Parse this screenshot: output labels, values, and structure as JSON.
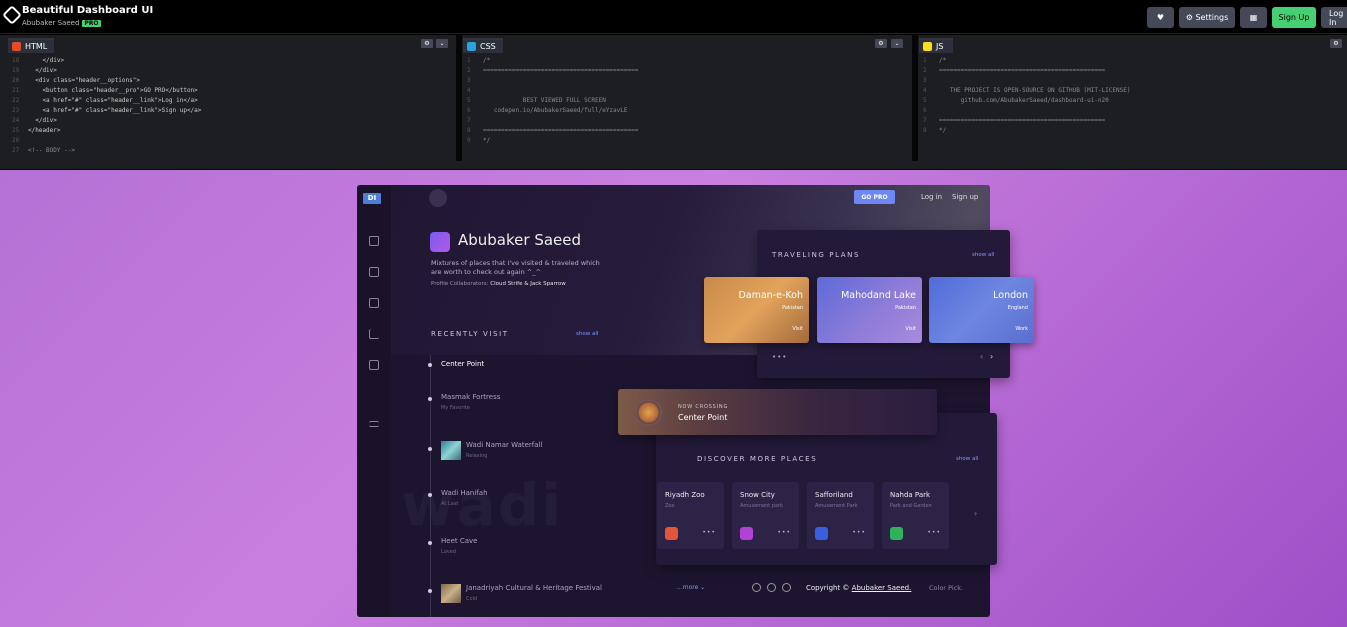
{
  "codepen": {
    "title": "Beautiful Dashboard UI",
    "author": "Abubaker Saeed",
    "badge": "PRO",
    "buttons": {
      "settings": "Settings",
      "signup": "Sign Up",
      "login": "Log In"
    }
  },
  "editors": {
    "html": {
      "label": "HTML",
      "lines": [
        {
          "n": "18",
          "t": "    </div>"
        },
        {
          "n": "19",
          "t": "  </div>"
        },
        {
          "n": "20",
          "t": "  <div class=\"header__options\">"
        },
        {
          "n": "21",
          "t": "    <button class=\"header__pro\">GO PRO</button>"
        },
        {
          "n": "22",
          "t": "    <a href=\"#\" class=\"header__link\">Log in</a>"
        },
        {
          "n": "23",
          "t": "    <a href=\"#\" class=\"header__link\">Sign up</a>"
        },
        {
          "n": "24",
          "t": "  </div>"
        },
        {
          "n": "25",
          "t": "</header>"
        },
        {
          "n": "26",
          "t": ""
        },
        {
          "n": "27",
          "t": "<!-- BODY -->"
        }
      ]
    },
    "css": {
      "label": "CSS",
      "lines": [
        {
          "n": "1",
          "t": "/*"
        },
        {
          "n": "2",
          "t": "==========================================="
        },
        {
          "n": "3",
          "t": ""
        },
        {
          "n": "4",
          "t": ""
        },
        {
          "n": "5",
          "t": "           BEST VIEWED FULL SCREEN"
        },
        {
          "n": "6",
          "t": "   codepen.io/AbubakerSaeed/full/eYzavLE"
        },
        {
          "n": "7",
          "t": ""
        },
        {
          "n": "8",
          "t": "==========================================="
        },
        {
          "n": "9",
          "t": "*/"
        }
      ]
    },
    "js": {
      "label": "JS",
      "lines": [
        {
          "n": "1",
          "t": "/*"
        },
        {
          "n": "2",
          "t": "=============================================="
        },
        {
          "n": "3",
          "t": ""
        },
        {
          "n": "4",
          "t": "   THE PROJECT IS OPEN-SOURCE ON GITHUB (MIT-LICENSE)"
        },
        {
          "n": "5",
          "t": "      github.com/AbubakerSaeed/dashboard-ui-n20"
        },
        {
          "n": "6",
          "t": ""
        },
        {
          "n": "7",
          "t": "=============================================="
        },
        {
          "n": "8",
          "t": "*/"
        }
      ]
    }
  },
  "dashboard": {
    "logo": "DI",
    "header": {
      "gopro": "GO PRO",
      "login": "Log in",
      "signup": "Sign up"
    },
    "profile": {
      "name": "Abubaker Saeed",
      "description": "Mixtures of places that I've visited & traveled which are worth to check out again ^_^",
      "collab_label": "Profile Collaborators:",
      "collab_names": "Cloud Strife & Jack Sparrow"
    },
    "recent": {
      "title": "RECENTLY VISIT",
      "showall": "show all",
      "items": [
        {
          "title": "Center Point",
          "sub": ""
        },
        {
          "title": "Masmak Fortress",
          "sub": "My Favorite"
        },
        {
          "title": "Wadi Namar Waterfall",
          "sub": "Relaxing"
        },
        {
          "title": "Wadi Hanifah",
          "sub": "At Last"
        },
        {
          "title": "Heet Cave",
          "sub": "Loved"
        },
        {
          "title": "Janadriyah Cultural & Heritage Festival",
          "sub": "Cold"
        }
      ],
      "bigword": "wadi",
      "more": "...more ⌄"
    },
    "traveling": {
      "title": "TRAVELING PLANS",
      "showall": "show all",
      "places": [
        {
          "name": "Daman-e-Koh",
          "country": "Pakistan",
          "tag": "Visit"
        },
        {
          "name": "Mahodand Lake",
          "country": "Pakistan",
          "tag": "Visit"
        },
        {
          "name": "London",
          "country": "England",
          "tag": "Work"
        }
      ]
    },
    "crossing": {
      "label": "NOW CROSSING",
      "place": "Center Point"
    },
    "discover": {
      "title": "DISCOVER MORE PLACES",
      "showall": "show all",
      "places": [
        {
          "name": "Riyadh Zoo",
          "type": "Zoo",
          "color": "#e0553b"
        },
        {
          "name": "Snow City",
          "type": "Amusement park",
          "color": "#b043d6"
        },
        {
          "name": "Safforiland",
          "type": "Amusement Park",
          "color": "#3a5ee0"
        },
        {
          "name": "Nahda Park",
          "type": "Park and Garden",
          "color": "#2fb35a"
        }
      ]
    },
    "footer": {
      "copyright_prefix": "Copyright ©",
      "copyright_name": "Abubaker Saeed.",
      "colorpick": "Color Pick."
    }
  }
}
